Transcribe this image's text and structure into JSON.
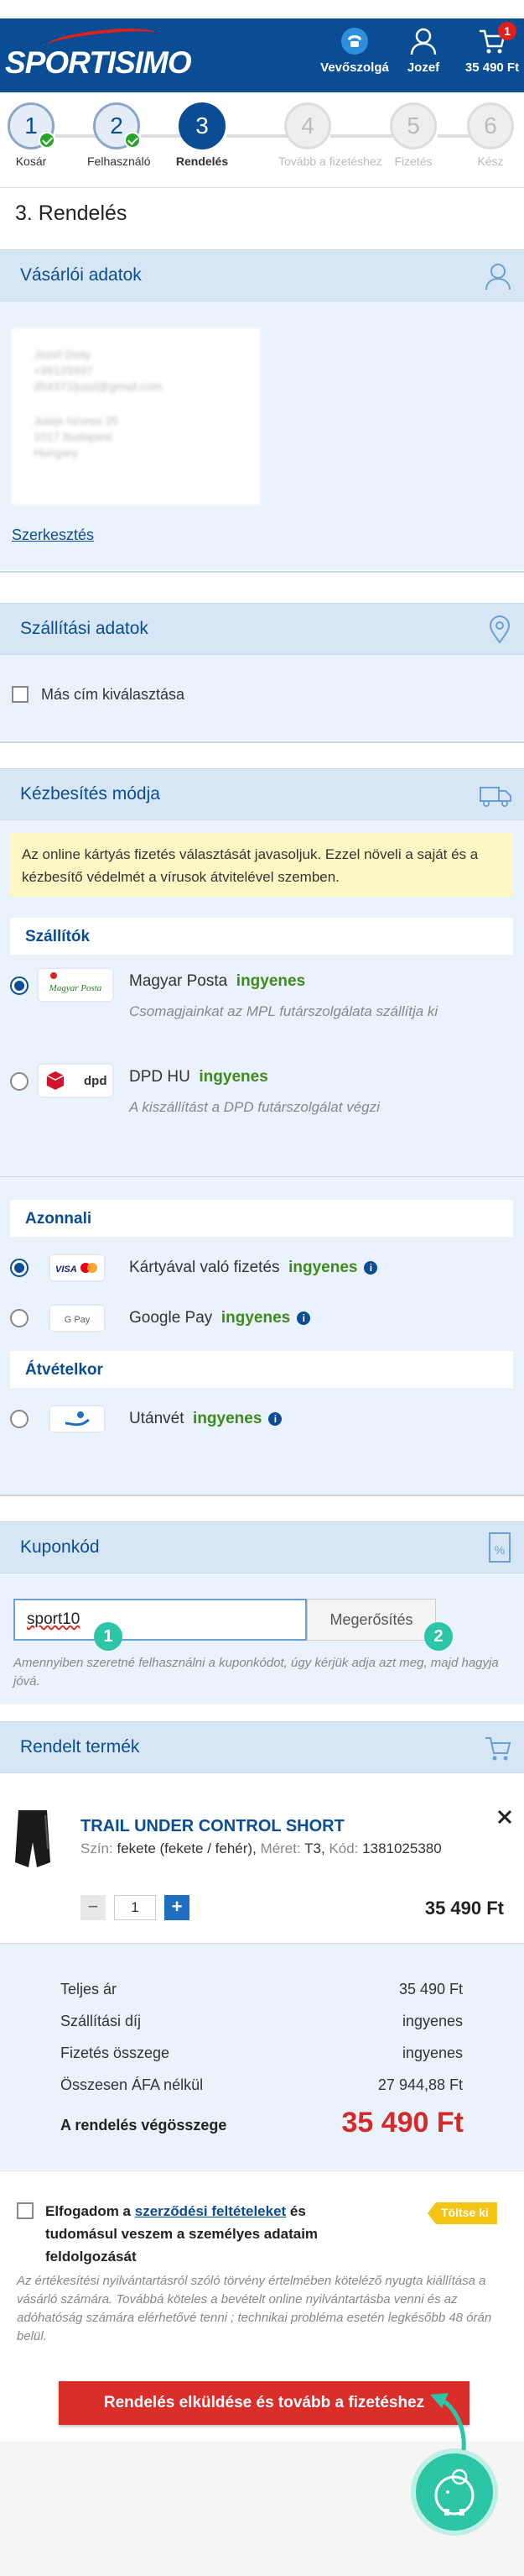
{
  "header": {
    "logo": "SPORTISIMO",
    "contact_label": "Vevőszolgá",
    "user_label": "Jozef",
    "cart_badge": "1",
    "cart_total": "35 490 Ft"
  },
  "steps": [
    {
      "num": "1",
      "label": "Kosár",
      "state": "done"
    },
    {
      "num": "2",
      "label": "Felhasználó",
      "state": "done"
    },
    {
      "num": "3",
      "label": "Rendelés",
      "state": "active"
    },
    {
      "num": "4",
      "label": "Tovább a fizetéshez",
      "state": "future"
    },
    {
      "num": "5",
      "label": "Fizetés",
      "state": "future"
    },
    {
      "num": "6",
      "label": "Kész",
      "state": "future"
    }
  ],
  "page_title": "3. Rendelés",
  "customer": {
    "title": "Vásárlói adatok",
    "name": "Jozef Dsiiy",
    "phone": "+36125937",
    "email": "d54371ljusd@gmail.com",
    "street": "Juiejs hirvres 25",
    "city": "1017 Budapest",
    "country": "Hungary",
    "edit_label": "Szerkesztés"
  },
  "shipping_address": {
    "title": "Szállítási adatok",
    "other_address_label": "Más cím kiválasztása"
  },
  "delivery": {
    "title": "Kézbesítés módja",
    "notice": "Az online kártyás fizetés választását javasoljuk. Ezzel növeli a saját és a kézbesítő védelmét a vírusok átvitelével szemben.",
    "carriers_label": "Szállítók",
    "carriers": [
      {
        "name": "Magyar Posta",
        "free": "ingyenes",
        "desc": "Csomagjainkat az MPL futárszolgálata szállítja ki",
        "logo": "Magyar Posta",
        "selected": true
      },
      {
        "name": "DPD HU",
        "free": "ingyenes",
        "desc": "A kiszállítást a DPD futárszolgálat végzi",
        "logo": "dpd",
        "selected": false
      }
    ],
    "immediate_label": "Azonnali",
    "payments": [
      {
        "name": "Kártyával való fizetés",
        "free": "ingyenes",
        "logo": "VISA",
        "selected": true
      },
      {
        "name": "Google Pay",
        "free": "ingyenes",
        "logo": "G Pay",
        "selected": false
      }
    ],
    "on_delivery_label": "Átvételkor",
    "cod": {
      "name": "Utánvét",
      "free": "ingyenes",
      "selected": false
    }
  },
  "coupon": {
    "title": "Kuponkód",
    "value": "sport10",
    "button": "Megerősítés",
    "marker1": "1",
    "marker2": "2",
    "hint": "Amennyiben szeretné felhasználni a kuponkódot, úgy kérjük adja azt meg, majd hagyja jóvá."
  },
  "ordered": {
    "title": "Rendelt termék",
    "product_name": "TRAIL UNDER CONTROL SHORT",
    "color_label": "Szín:",
    "color_value": "fekete (fekete / fehér),",
    "size_label": "Méret:",
    "size_value": "T3,",
    "code_label": "Kód:",
    "code_value": "1381025380",
    "qty": "1",
    "price": "35 490 Ft"
  },
  "summary": {
    "rows": [
      {
        "label": "Teljes ár",
        "value": "35 490 Ft"
      },
      {
        "label": "Szállítási díj",
        "value": "ingyenes"
      },
      {
        "label": "Fizetés összege",
        "value": "ingyenes"
      },
      {
        "label": "Összesen ÁFA nélkül",
        "value": "27 944,88 Ft"
      }
    ],
    "total_label": "A rendelés végösszege",
    "total_value": "35 490 Ft"
  },
  "terms": {
    "text_a": "Elfogadom a ",
    "link": "szerződési feltételeket",
    "text_b": " és tudomásul veszem a személyes adataim feldolgozását",
    "fill_badge": "Töltse ki",
    "legal": "Az értékesítési nyilvántartásról szóló törvény értelmében köteléző nyugta kiállítása a vásárló számára. Továbbá köteles a bevételt online nyilvántartásba venni és az adóhatóság számára elérhetővé tenni ; technikai probléma esetén legkésőbb 48 órán belül."
  },
  "submit_label": "Rendelés elküldése és tovább a fizetéshez",
  "colors": {
    "brand": "#0b4d94",
    "accent_red": "#e0201b",
    "free_green": "#3f8a1f",
    "teal": "#2cc6a6"
  }
}
